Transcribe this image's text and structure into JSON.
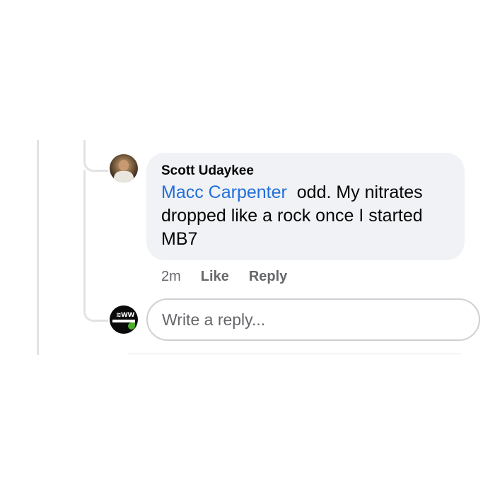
{
  "comment": {
    "author": "Scott Udaykee",
    "mention": "Macc Carpenter",
    "text": "odd. My nitrates dropped like a rock once I started MB7",
    "timestamp": "2m",
    "like_label": "Like",
    "reply_label": "Reply"
  },
  "reply_box": {
    "placeholder": "Write a reply..."
  },
  "colors": {
    "mention": "#216fdb",
    "bubble_bg": "#f0f2f5",
    "secondary_text": "#65676b"
  }
}
